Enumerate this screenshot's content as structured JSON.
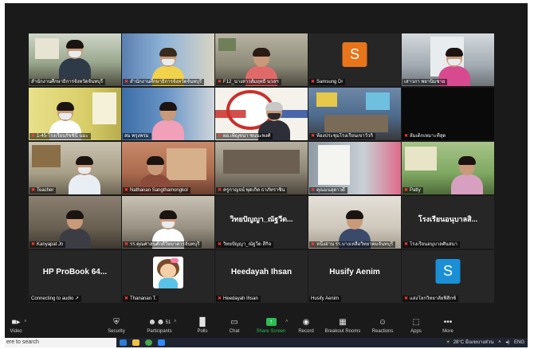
{
  "tiles": [
    {
      "label": "สำนักงานศึกษาธิการจังหวัดจันทบุรี",
      "active": true,
      "mic": false
    },
    {
      "label": "สำนักงานศึกษาธิการจังหวัดจันทบุรี",
      "active": false,
      "mic": true
    },
    {
      "label": "F12_นางสาวสัมฤทธิ์ นวลฯ",
      "active": false,
      "mic": true
    },
    {
      "label": "Samsung Dr",
      "active": false,
      "mic": true,
      "avatar": "S",
      "avatar_color": "#e8751a"
    },
    {
      "label": "เสาวภา พยานิมชาย",
      "active": false,
      "mic": false
    },
    {
      "label": "1-45-โรงเรียนรัชชินี นมะ",
      "active": false,
      "mic": true
    },
    {
      "label": "สม พรุงพรม",
      "active": false,
      "mic": false
    },
    {
      "label": "ผอ.เพ็ญชนา ชนนะพงศ์",
      "active": false,
      "mic": true
    },
    {
      "label": "ห้องประชุมโรงเรียนเขาวัวกิ",
      "active": false,
      "mic": true
    },
    {
      "label": "ส้มเด็กเหมาะที่สุด",
      "active": false,
      "mic": true
    },
    {
      "label": "Teacher",
      "active": false,
      "mic": true
    },
    {
      "label": "Nathanan Sangthamongkol",
      "active": false,
      "mic": true
    },
    {
      "label": "ครูกาญจน์ พุดเกิด ธาภัทราชิน",
      "active": false,
      "mic": true
    },
    {
      "label": "คุณมนสุดาวดี",
      "active": false,
      "mic": true
    },
    {
      "label": "Patty",
      "active": false,
      "mic": true
    },
    {
      "label": "Kanyapat Jn",
      "active": false,
      "mic": true
    },
    {
      "label": "รร.คุณศาสนศักดิ์วิทยาคารจันทบุรี",
      "active": false,
      "mic": true
    },
    {
      "label": "วิทยปัญญา_ณัฐวีด สีกิจ",
      "active": false,
      "mic": true,
      "big": "วิทยปัญญา_ณัฐวีด...",
      "big_thai": true
    },
    {
      "label": "หนึ่งอ่าน รร.บางเหลือวิทยาคมจันทบุรี",
      "active": false,
      "mic": true
    },
    {
      "label": "โรงเรียนอนุบาลศันสนา",
      "active": false,
      "mic": true,
      "big": "โรงเรียนอนุบาลสิ...",
      "big_thai": true
    },
    {
      "label": "Connecting to audio",
      "active": false,
      "mic": false,
      "big": "HP ProBook 64..."
    },
    {
      "label": "Thananan T.",
      "active": false,
      "mic": true,
      "cartoon": true
    },
    {
      "label": "Heedayah Ihsan",
      "active": false,
      "mic": true,
      "big": "Heedayah Ihsan"
    },
    {
      "label": "Husify Aenim",
      "active": false,
      "mic": false,
      "big": "Husify Aenim"
    },
    {
      "label": "แสงโลกวิทยาลัยฟิสิกซ์",
      "active": false,
      "mic": true,
      "avatar": "S",
      "avatar_color": "#1b8fd6"
    }
  ],
  "toolbar": {
    "video": "Video",
    "security": "Security",
    "participants": "Participants",
    "participants_count": "51",
    "polls": "Polls",
    "chat": "Chat",
    "share_screen": "Share Screen",
    "record": "Record",
    "breakout_rooms": "Breakout Rooms",
    "reactions": "Reactions",
    "apps": "Apps",
    "more": "More"
  },
  "taskbar": {
    "search_placeholder": "ere to search",
    "weather": "28°C มีเมฆบางส่วน",
    "language": "ENG"
  },
  "colors": {
    "active_speaker": "#d6e34a",
    "share_green": "#2dbd54",
    "muted_red": "#ff3b30"
  }
}
